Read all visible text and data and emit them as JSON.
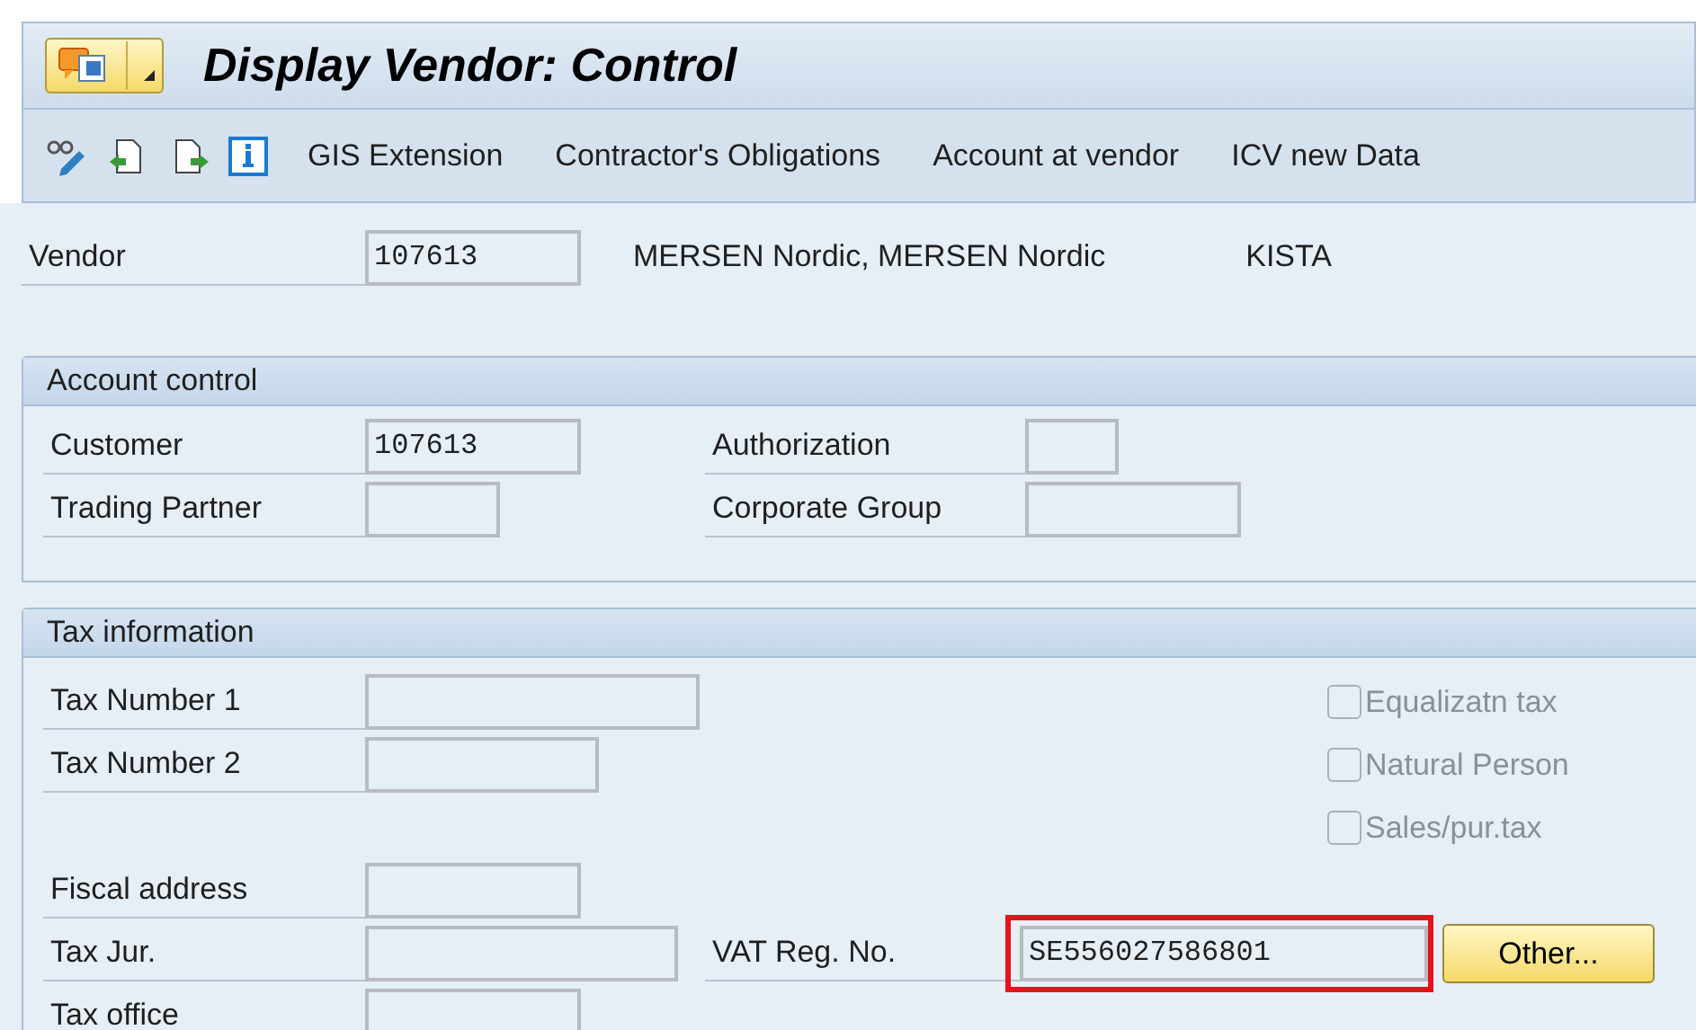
{
  "title_bar": {
    "title": "Display Vendor: Control"
  },
  "toolbar": {
    "text_buttons": [
      "GIS Extension",
      "Contractor's Obligations",
      "Account at vendor",
      "ICV new Data"
    ]
  },
  "vendor": {
    "label": "Vendor",
    "value": "107613",
    "name": "MERSEN Nordic, MERSEN Nordic",
    "city": "KISTA"
  },
  "account_control": {
    "title": "Account control",
    "rows": [
      [
        {
          "label": "Customer",
          "value": "107613"
        },
        {
          "label": "Authorization"
        }
      ],
      [
        {
          "label": "Trading Partner"
        },
        {
          "label": "Corporate Group"
        }
      ]
    ]
  },
  "tax_information": {
    "title": "Tax information",
    "rows": [
      {
        "fields": [
          {
            "label": "Tax Number 1"
          }
        ],
        "checkbox": {
          "label": "Equalizatn tax",
          "checked": false,
          "disabled": true
        }
      },
      {
        "fields": [
          {
            "label": "Tax Number 2"
          }
        ],
        "checkbox": {
          "label": "Natural Person",
          "checked": false,
          "disabled": true
        }
      },
      {
        "fields": [],
        "checkbox": {
          "label": "Sales/pur.tax",
          "checked": false,
          "disabled": true
        }
      },
      {
        "fields": [
          {
            "label": "Fiscal address"
          }
        ]
      },
      {
        "fields": [
          {
            "label": "Tax Jur."
          },
          {
            "label": "VAT Reg. No.",
            "value": "SE556027586801",
            "highlighted": true
          }
        ],
        "button": "Other..."
      },
      {
        "fields": [
          {
            "label": "Tax office"
          }
        ]
      }
    ]
  }
}
